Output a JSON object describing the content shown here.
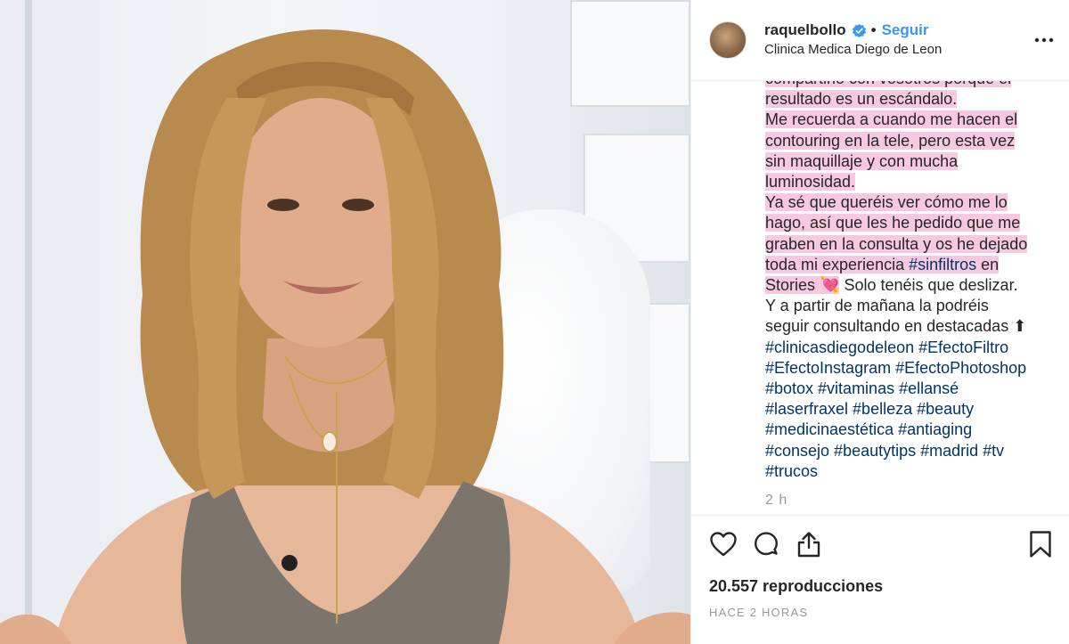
{
  "header": {
    "username": "raquelbollo",
    "separator": "•",
    "follow_label": "Seguir",
    "location": "Clinica Medica Diego de Leon"
  },
  "caption": {
    "lines": [
      {
        "segments": [
          {
            "text": "compartirlo con vosotros porque el",
            "type": "hl"
          }
        ]
      },
      {
        "segments": [
          {
            "text": "resultado es un escándalo.",
            "type": "hl"
          }
        ]
      },
      {
        "segments": [
          {
            "text": "Me recuerda a cuando me hacen el",
            "type": "hl"
          }
        ]
      },
      {
        "segments": [
          {
            "text": "contouring en la tele, pero esta vez",
            "type": "hl"
          }
        ]
      },
      {
        "segments": [
          {
            "text": "sin maquillaje y con mucha",
            "type": "hl"
          }
        ]
      },
      {
        "segments": [
          {
            "text": "luminosidad.",
            "type": "hl"
          }
        ]
      },
      {
        "segments": [
          {
            "text": "Ya sé que queréis ver cómo me lo",
            "type": "hl"
          }
        ]
      },
      {
        "segments": [
          {
            "text": "hago, así que les he pedido que me",
            "type": "hl"
          }
        ]
      },
      {
        "segments": [
          {
            "text": "graben en la consulta y os he dejado",
            "type": "hl"
          }
        ]
      },
      {
        "segments": [
          {
            "text": "toda mi experiencia ",
            "type": "hl"
          },
          {
            "text": "#sinfiltros",
            "type": "hltag"
          },
          {
            "text": " en",
            "type": "hl"
          }
        ]
      },
      {
        "segments": [
          {
            "text": "Stories 💘",
            "type": "hl"
          },
          {
            "text": "  Solo tenéis que deslizar.",
            "type": "plain"
          }
        ]
      },
      {
        "segments": [
          {
            "text": "Y a partir de mañana la podréis",
            "type": "plain"
          }
        ]
      },
      {
        "segments": [
          {
            "text": "seguir consultando en destacadas ⬆",
            "type": "plain"
          }
        ]
      },
      {
        "segments": [
          {
            "text": "#clinicasdiegodeleon #EfectoFiltro",
            "type": "tag"
          }
        ]
      },
      {
        "segments": [
          {
            "text": "#EfectoInstagram #EfectoPhotoshop",
            "type": "tag"
          }
        ]
      },
      {
        "segments": [
          {
            "text": "#botox #vitaminas #ellansé",
            "type": "tag"
          }
        ]
      },
      {
        "segments": [
          {
            "text": "#laserfraxel #belleza #beauty",
            "type": "tag"
          }
        ]
      },
      {
        "segments": [
          {
            "text": "#medicinaestética #antiaging",
            "type": "tag"
          }
        ]
      },
      {
        "segments": [
          {
            "text": "#consejo #beautytips #madrid #tv",
            "type": "tag"
          }
        ]
      },
      {
        "segments": [
          {
            "text": "#trucos",
            "type": "tag"
          }
        ]
      }
    ],
    "time_ago": "2 h"
  },
  "actions": {
    "like_icon": "heart-icon",
    "comment_icon": "comment-icon",
    "share_icon": "share-icon",
    "save_icon": "bookmark-icon"
  },
  "stats": {
    "views": "20.557 reproducciones",
    "posted": "HACE 2 HORAS"
  },
  "colors": {
    "highlight": "#f6c9e0",
    "follow": "#3897f0",
    "hashtag": "#003569",
    "muted": "#999999"
  }
}
